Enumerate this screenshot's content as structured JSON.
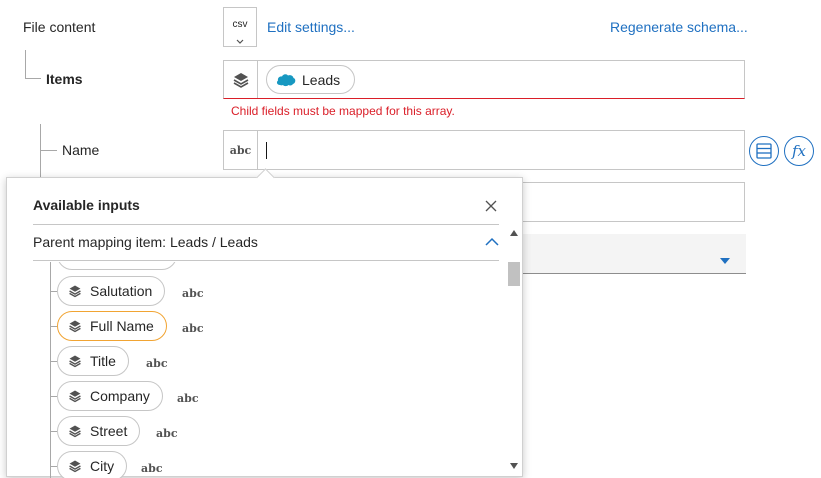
{
  "file_content": {
    "label": "File content",
    "format_badge": "csv",
    "edit_settings_link": "Edit settings...",
    "regenerate_link": "Regenerate schema..."
  },
  "items_field": {
    "label": "Items",
    "pill_label": "Leads",
    "error_text": "Child fields must be mapped for this array.",
    "error_color": "#da1e28"
  },
  "name_field": {
    "label": "Name",
    "type_badge": "abc",
    "value": ""
  },
  "icons": {
    "layers": "layers-icon",
    "salesforce": "salesforce-logo-icon",
    "list": "list-icon",
    "fx": "function-icon"
  },
  "fx_label": "fx",
  "popover": {
    "title": "Available inputs",
    "parent_mapping": "Parent mapping item: Leads / Leads",
    "items": [
      {
        "label": "Salutation",
        "type": "abc"
      },
      {
        "label": "Full Name",
        "type": "abc",
        "selected": true
      },
      {
        "label": "Title",
        "type": "abc"
      },
      {
        "label": "Company",
        "type": "abc"
      },
      {
        "label": "Street",
        "type": "abc"
      },
      {
        "label": "City",
        "type": "abc"
      }
    ],
    "partial_item_type": "abc"
  },
  "colors": {
    "accent": "#1f70c1",
    "selected_border": "#f1a433",
    "error": "#da1e28"
  }
}
